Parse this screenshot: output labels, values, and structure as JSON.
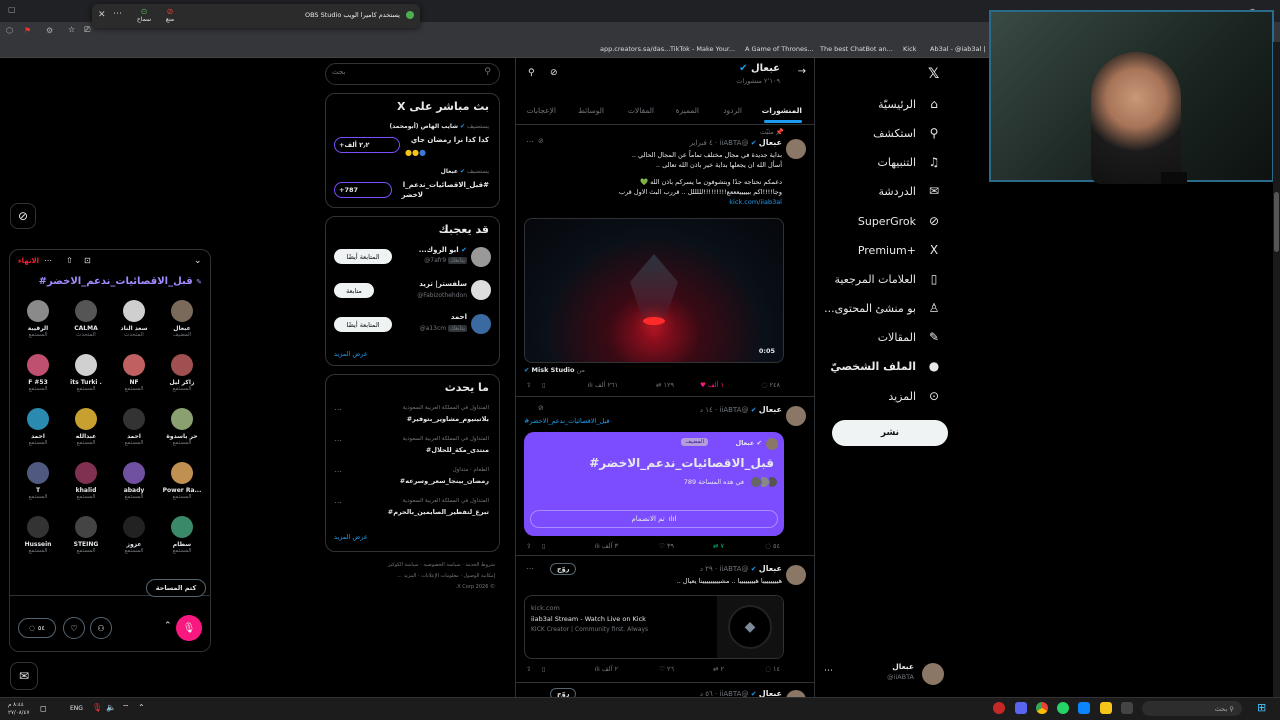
{
  "browser": {
    "bookmarks": [
      "app.creators.sa/das...",
      "TikTok - Make Your...",
      "A Game of Thrones...",
      "The best ChatBot an...",
      "Kick",
      "Ab3al - @iab3al | C..."
    ],
    "obs_popup": {
      "text": "OBS Studio يستخدم كاميرا الويب",
      "btn1": "منع",
      "btn2": "سماح"
    }
  },
  "nav": {
    "items": [
      {
        "label": "الرئيسيّة",
        "icon": "⌂"
      },
      {
        "label": "استكشف",
        "icon": "⚲"
      },
      {
        "label": "التنبيهات",
        "icon": "♫"
      },
      {
        "label": "الدردشة",
        "icon": "✉"
      },
      {
        "label": "SuperGrok",
        "icon": "⊘"
      },
      {
        "label": "Premium+",
        "icon": "X"
      },
      {
        "label": "العلامات المرجعية",
        "icon": "▯"
      },
      {
        "label": "...بو منشئ المحتوى",
        "icon": "♙"
      },
      {
        "label": "المقالات",
        "icon": "✎"
      },
      {
        "label": "الملف الشخصيّ",
        "icon": "●"
      },
      {
        "label": "المزيد",
        "icon": "⊙"
      }
    ],
    "post_button": "نشر",
    "account_name": "عبعال",
    "account_handle": "@iiABTA"
  },
  "profile": {
    "name": "عبعال",
    "posts_count": "٢٬١٠٩ منشورات",
    "tabs": [
      "المنشورات",
      "الردود",
      "المميزة",
      "المقالات",
      "الوسائط",
      "الإعجابات"
    ]
  },
  "posts": [
    {
      "pinned": "مثبّت",
      "name": "عبعال",
      "handle": "@iiABTA",
      "time": "٤ فبراير",
      "lines": [
        "بداية جديدة في مجال مختلف تماماً عن المجال الحالي ..",
        "أسأل الله ان يجعلها بداية خير باذن الله تعالى ..",
        "دعمكم نحتاجه جدًا وبتشوفون ما يسركم باذن الله 💚",
        "وجا!!!!اكم بيييييعععع!!!!!!!!!لللللل .. قررب البث الاول قرب"
      ],
      "link": "kick.com/iiab3al",
      "video_time": "0:05",
      "from": "Misk Studio",
      "from_prefix": "من",
      "replies": "٢٤٨",
      "reposts": "١٢٩",
      "likes": "١ ألف",
      "views": "٢٦١ ألف"
    },
    {
      "name": "عبعال",
      "handle": "@iiABTA",
      "time": "١٤ د",
      "hashtag": "#قبل_الاقصائيات_ندعم_الاخضر",
      "space_host": "عبعال",
      "space_badge": "المضيف",
      "space_title": "#قبل_الاقصائيات_ندعم_الاخضر",
      "space_count": "789 في هذه المساحة",
      "space_join": "تم الانضمام",
      "replies": "٥٤",
      "reposts": "٧",
      "likes": "٣٩",
      "views": "٣ آلف"
    },
    {
      "name": "عبعال",
      "handle": "@iiABTA",
      "time": "٢٩ د",
      "badge": "روّج",
      "text": "هييييييييا هييييييييا .. مشييييييييينا يعيال ..",
      "card_domain": "kick.com",
      "card_title": "iiab3al Stream - Watch Live on Kick",
      "card_desc": "KICK Creator | Community first. Always",
      "replies": "١٤",
      "reposts": "٢",
      "likes": "٢٦",
      "views": "٢ آلف"
    },
    {
      "name": "عبعال",
      "handle": "@iiABTA",
      "time": "٥٦ د",
      "badge": "روّج"
    }
  ],
  "sidebar": {
    "search_placeholder": "بحث",
    "live": {
      "title": "X بث مباشر على",
      "items": [
        {
          "speaking": "يستضيف",
          "host": "شايب الهاص (أبومحمد)",
          "title": "كدا كدا نرا رمضان جاي",
          "count": "+٢٫٢ ألف"
        },
        {
          "speaking": "يستضيف",
          "host": "عبعال",
          "title": "قبل_الاقصائيات_ندعم_ا#",
          "title2": "لاخضر",
          "count": "+787"
        }
      ]
    },
    "follow": {
      "title": "قد يعجبك",
      "items": [
        {
          "name": "...ابو الروك",
          "handle": "@7afr9",
          "tag": "يتابعك",
          "btn": "المتابعة أيضًا"
        },
        {
          "name": "سلفستر| تريد",
          "handle": "@Fabizothehdon",
          "btn": "متابعة"
        },
        {
          "name": "احمد",
          "handle": "@a13cm",
          "tag": "يتابعك",
          "btn": "المتابعة أيضًا"
        }
      ],
      "more": "عرض المزيد"
    },
    "trends": {
      "title": "ما يحدث",
      "items": [
        {
          "context": "المتداول في المملكة العربية السعودية",
          "tag": "#بلاتينيوم_مشاوير_بتوفير"
        },
        {
          "context": "المتداول في المملكة العربية السعودية",
          "tag": "#منتدى_مكة_للحلال"
        },
        {
          "context": "الطعام · متداول",
          "tag": "#رمضان_بينجا_سعر_وسرعه"
        },
        {
          "context": "المتداول في المملكة العربية السعودية",
          "tag": "#تبرع_لتفطير_الصايمين_بالحرم"
        }
      ],
      "more": "عرض المزيد"
    },
    "footer": [
      "شروط الخدمة",
      "سياسة الخصوصية",
      "سياسة الكوكيز",
      "إمكانية الوصول",
      "معلومات الإعلانات",
      "المزيد ...",
      "© 2026 X Corp."
    ]
  },
  "space": {
    "end": "الانهاء",
    "title": "#قبل_الاقصائيات_ندعم_الاخضر",
    "speakers": [
      {
        "name": "عبعال",
        "role": "المضيف",
        "color": "#7a6a5a"
      },
      {
        "name": "سعد الناد",
        "role": "المتحدث",
        "color": "#cfcfcf"
      },
      {
        "name": "CALMA",
        "role": "المتحدث",
        "color": "#555"
      },
      {
        "name": "الرقيبة",
        "role": "المستمع",
        "color": "#8a8a8a"
      },
      {
        "name": "زاكر ليل",
        "role": "المستمع",
        "color": "#a05050"
      },
      {
        "name": "NF",
        "role": "المستمع",
        "color": "#c06060"
      },
      {
        "name": "its Turki .",
        "role": "المستمع",
        "color": "#d0d0d0"
      },
      {
        "name": "F #53",
        "role": "المستمع",
        "color": "#c05070"
      },
      {
        "name": "حر باسدوة",
        "role": "المستمع",
        "color": "#8aa070"
      },
      {
        "name": "احمد",
        "role": "المستمع",
        "color": "#333"
      },
      {
        "name": "عبدالله",
        "role": "المستمع",
        "color": "#c8a030"
      },
      {
        "name": "احمد",
        "role": "المستمع",
        "color": "#2a8ab0"
      },
      {
        "name": "Power Ra...",
        "role": "المستمع",
        "color": "#c09050"
      },
      {
        "name": "abady",
        "role": "المستمع",
        "color": "#7050a0"
      },
      {
        "name": "khalid",
        "role": "المستمع",
        "color": "#803050"
      },
      {
        "name": "T",
        "role": "المستمع",
        "color": "#505a80"
      },
      {
        "name": "سطام",
        "role": "المستمع",
        "color": "#3a8a6a"
      },
      {
        "name": "عزوز",
        "role": "المستمع",
        "color": "#222"
      },
      {
        "name": "STEING",
        "role": "المستمع",
        "color": "#444"
      },
      {
        "name": "Hussein",
        "role": "المستمع",
        "color": "#333"
      }
    ],
    "mute_label": "كتم المساحة",
    "comment_count": "٥٤"
  },
  "taskbar": {
    "search": "بحث",
    "lang": "ENG",
    "time": "٨:٤٤ م",
    "date": "٢٧/٠٨/٤٧"
  },
  "colors": {
    "accent": "#1d9bf0",
    "purple": "#7c4dff",
    "pink": "#f91880",
    "green": "#00ba7c"
  }
}
